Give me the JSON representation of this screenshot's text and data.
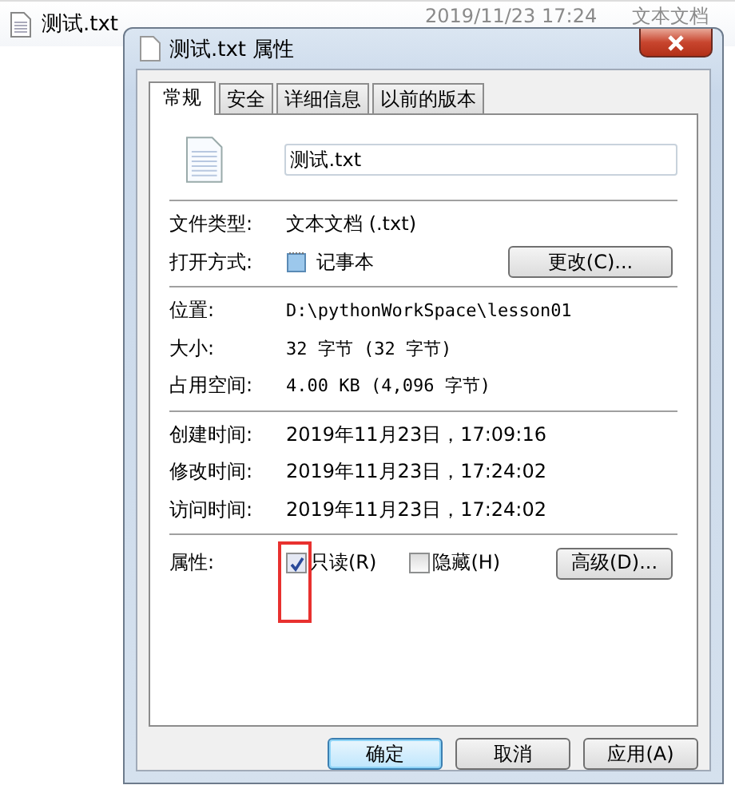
{
  "background_row": {
    "name": "测试.txt",
    "date": "2019/11/23 17:24",
    "type": "文本文档"
  },
  "window": {
    "title": "测试.txt 属性"
  },
  "tabs": [
    {
      "label": "常规",
      "selected": true
    },
    {
      "label": "安全",
      "selected": false
    },
    {
      "label": "详细信息",
      "selected": false
    },
    {
      "label": "以前的版本",
      "selected": false
    }
  ],
  "file_name": "测试.txt",
  "type_row": {
    "label": "文件类型:",
    "value": "文本文档 (.txt)"
  },
  "open_with": {
    "label": "打开方式:",
    "value": "记事本",
    "button": "更改(C)..."
  },
  "location_rows": [
    {
      "label": "位置:",
      "value": "D:\\pythonWorkSpace\\lesson01"
    },
    {
      "label": "大小:",
      "value": "32 字节 (32 字节)"
    },
    {
      "label": "占用空间:",
      "value": "4.00 KB (4,096 字节)"
    }
  ],
  "time_rows": [
    {
      "label": "创建时间:",
      "value": "2019年11月23日，17:09:16"
    },
    {
      "label": "修改时间:",
      "value": "2019年11月23日，17:24:02"
    },
    {
      "label": "访问时间:",
      "value": "2019年11月23日，17:24:02"
    }
  ],
  "attributes": {
    "label": "属性:",
    "items": [
      {
        "label": "只读(R)",
        "checked": true,
        "highlighted": true
      },
      {
        "label": "隐藏(H)",
        "checked": false,
        "highlighted": false
      }
    ],
    "button": "高级(D)..."
  },
  "buttons": [
    {
      "label": "确定",
      "default": true
    },
    {
      "label": "取消",
      "default": false
    },
    {
      "label": "应用(A)",
      "default": false
    }
  ]
}
